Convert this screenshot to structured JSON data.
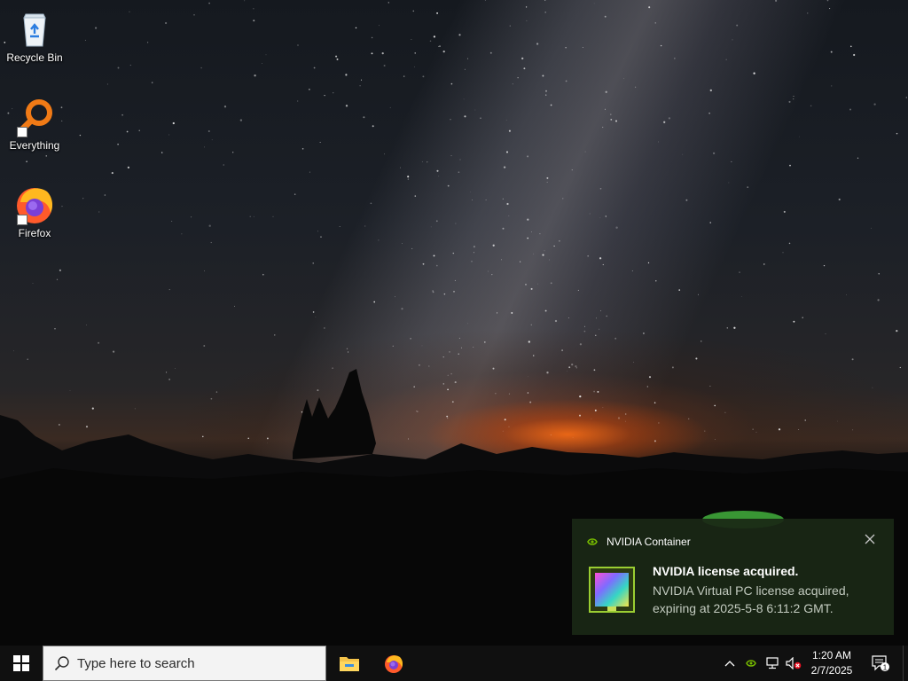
{
  "desktop": {
    "icons": [
      {
        "label": "Recycle Bin",
        "icon": "recycle-bin-icon"
      },
      {
        "label": "Everything",
        "icon": "everything-search-icon"
      },
      {
        "label": "Firefox",
        "icon": "firefox-icon"
      }
    ]
  },
  "notification": {
    "app_name": "NVIDIA Container",
    "title": "NVIDIA license acquired.",
    "body": "NVIDIA Virtual PC license acquired, expiring at 2025-5-8 6:11:2 GMT.",
    "app_icon": "nvidia-icon",
    "accent_color": "#76b900"
  },
  "taskbar": {
    "search_placeholder": "Type here to search",
    "pinned_apps": [
      {
        "name": "File Explorer",
        "icon": "file-explorer-icon"
      },
      {
        "name": "Firefox",
        "icon": "firefox-icon"
      }
    ],
    "tray": {
      "icons": [
        "chevron-up-icon",
        "nvidia-icon",
        "network-icon",
        "volume-muted-icon"
      ],
      "time": "1:20 AM",
      "date": "2/7/2025",
      "notification_count": "1"
    }
  }
}
